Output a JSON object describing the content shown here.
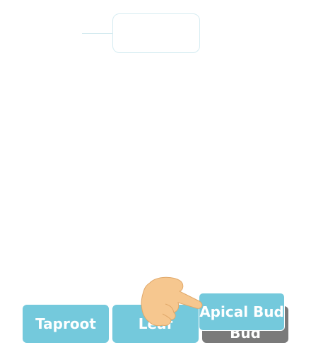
{
  "drop_zone": {
    "label": ""
  },
  "tiles": [
    {
      "label": "Taproot"
    },
    {
      "label": "Leaf"
    },
    {
      "label": "Apical Bud"
    }
  ],
  "shadow_tile": {
    "label": "Bud"
  },
  "icons": {
    "hand": "pointing-hand-icon"
  },
  "colors": {
    "tile": "#74c9dc",
    "shadow": "#7a7a7a",
    "outline": "#d6ecf2",
    "hand": "#f6c78f"
  }
}
